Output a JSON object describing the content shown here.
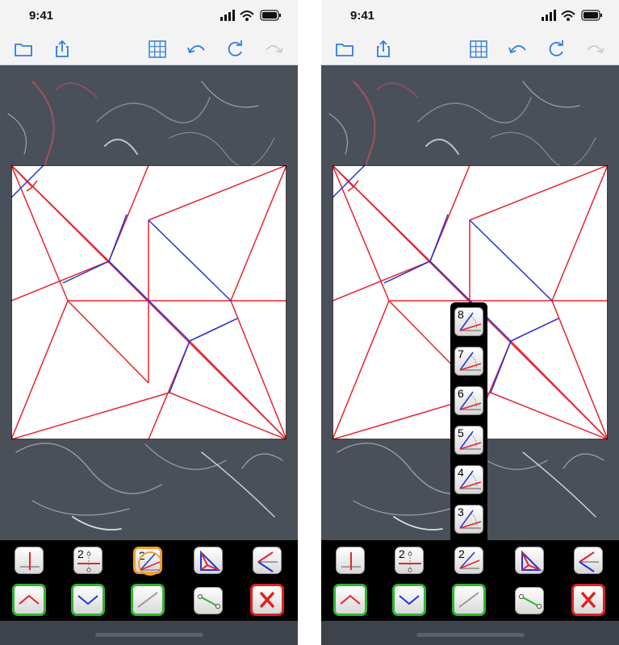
{
  "status": {
    "time": "9:41"
  },
  "colors": {
    "mountain": "#e8232d",
    "valley": "#1f35d6",
    "accent": "#2f7de0",
    "active_frame": "#2fb52f",
    "delete_frame": "#e02020"
  },
  "toolbar": {
    "icons": [
      "folder-icon",
      "share-icon",
      "grid-icon",
      "undo-icon",
      "redo-icon",
      "forward-icon"
    ]
  },
  "tools": {
    "row1": [
      "perpendicular-tool",
      "divide-tool",
      "angle-bisector-tool",
      "triangle-tool",
      "symmetric-tool"
    ],
    "divide_label": "2",
    "angle_label": "2",
    "row2": [
      "mountain-fold",
      "valley-fold",
      "auxiliary-line",
      "edge-line",
      "delete-tool"
    ]
  },
  "angle_menu": {
    "labels": [
      "8",
      "7",
      "6",
      "5",
      "4",
      "3"
    ]
  }
}
